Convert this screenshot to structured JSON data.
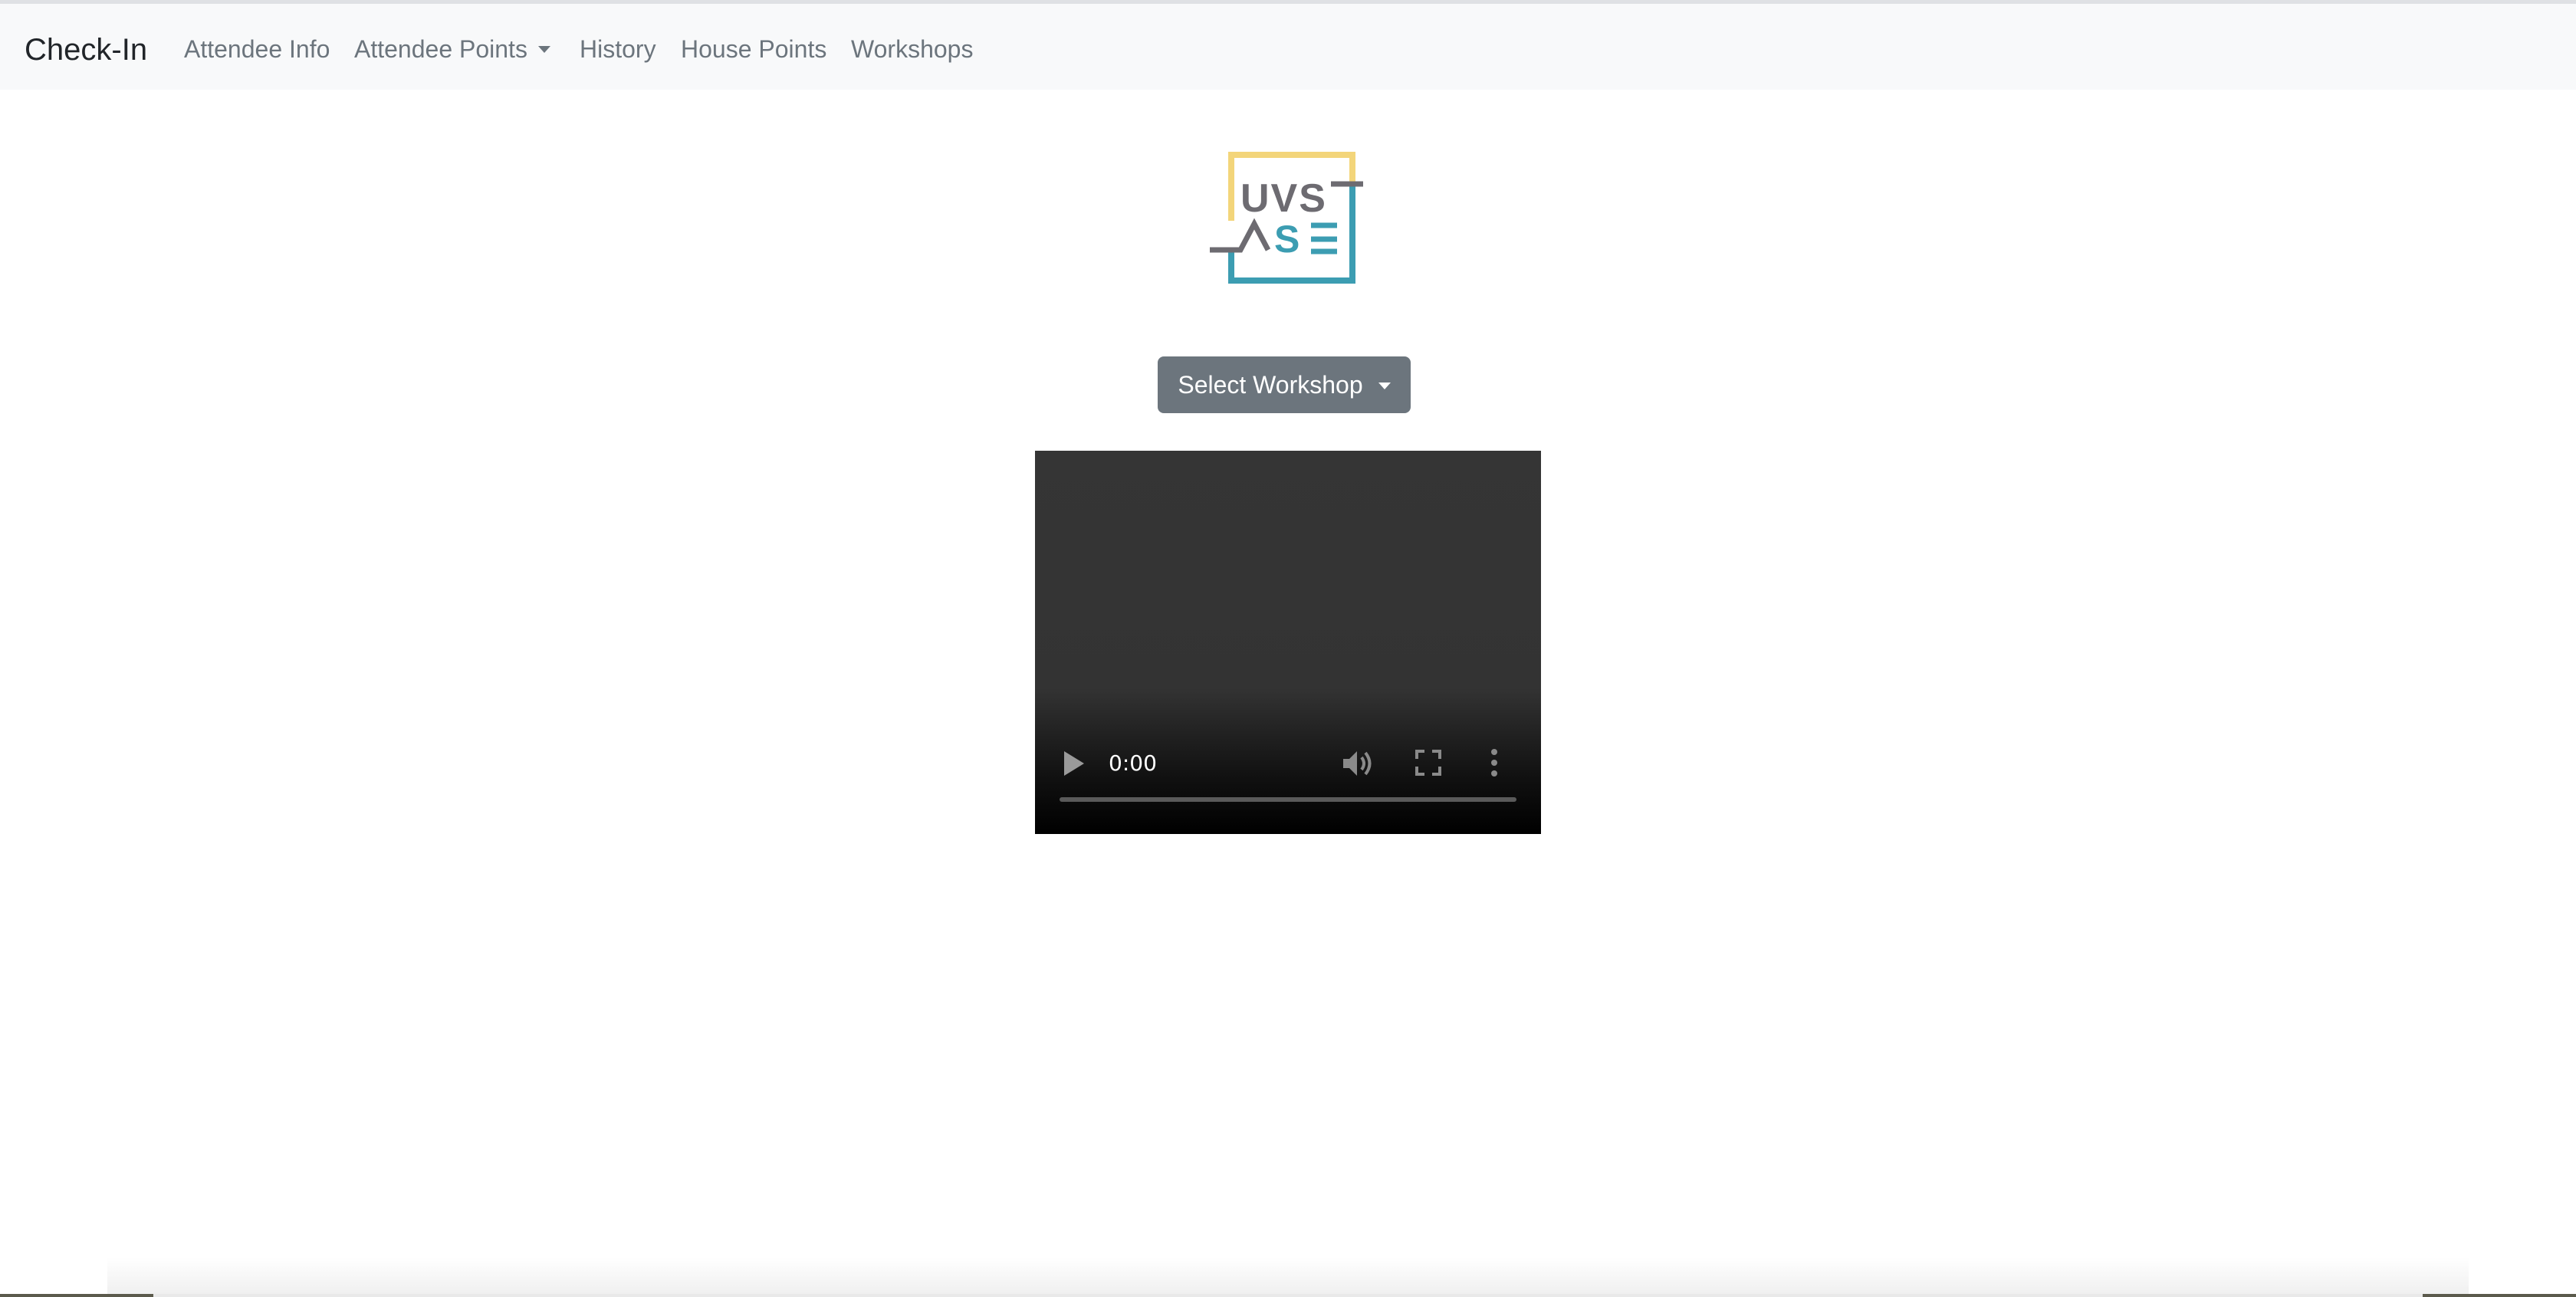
{
  "navbar": {
    "brand": "Check-In",
    "links": [
      {
        "label": "Attendee Info"
      },
      {
        "label": "Attendee Points",
        "dropdown": true
      },
      {
        "label": "History"
      },
      {
        "label": "House Points"
      },
      {
        "label": "Workshops"
      }
    ],
    "background": "#f8f9fa"
  },
  "logo": {
    "top_text": "UVS",
    "bottom_text": "ASE",
    "colors": {
      "yellow": "#f3d57a",
      "teal": "#3c9db2",
      "gray": "#6d6b71"
    }
  },
  "workshop_select": {
    "label": "Select Workshop",
    "color": "#6c757d"
  },
  "video_player": {
    "time": "0:00",
    "icons": [
      "play-icon",
      "volume-icon",
      "fullscreen-icon",
      "more-options-icon"
    ]
  }
}
